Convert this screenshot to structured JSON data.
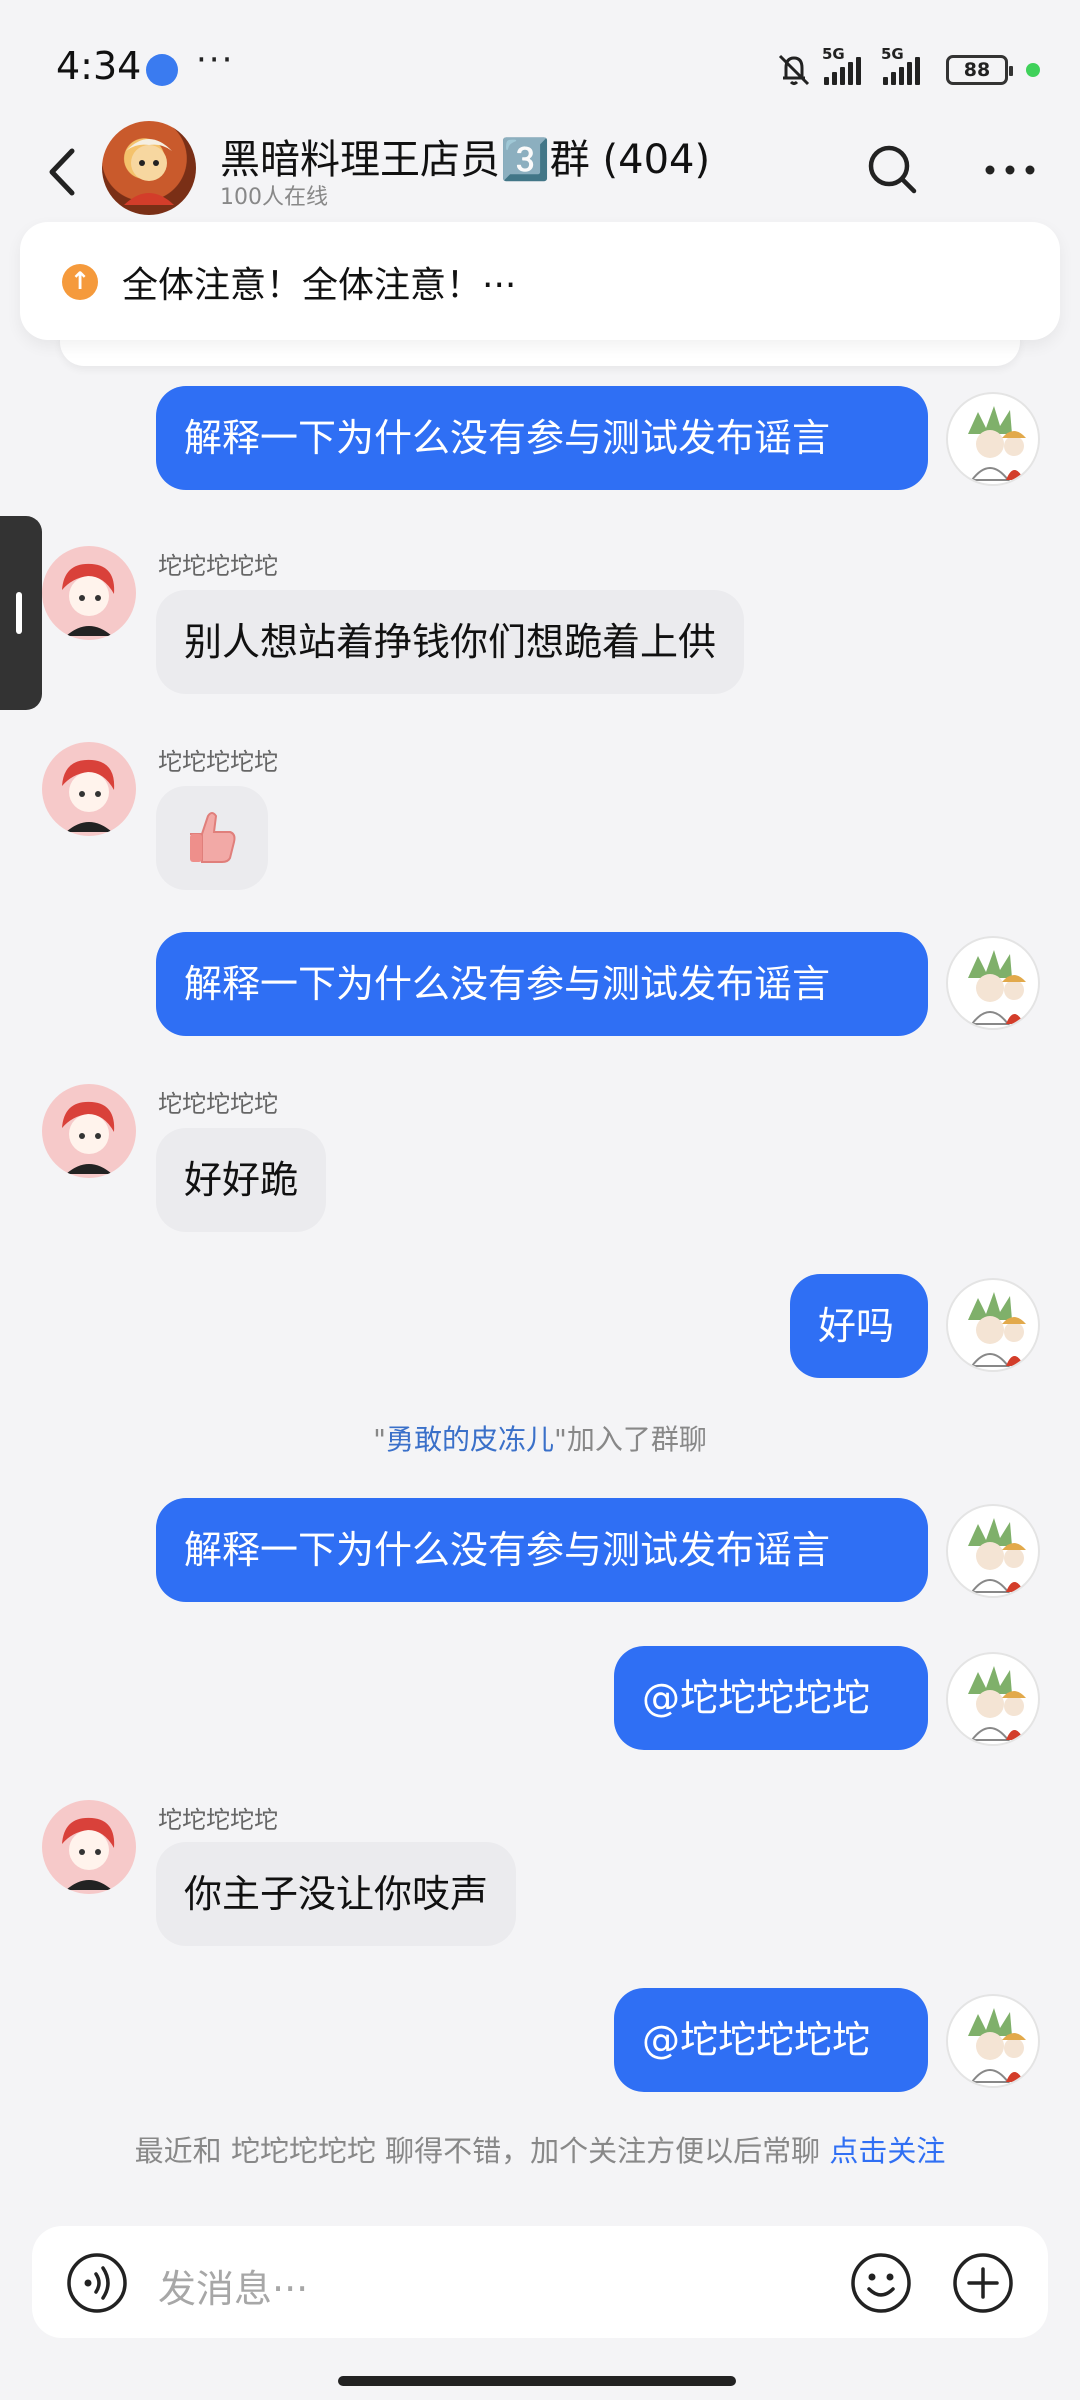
{
  "status_bar": {
    "time": "4:34",
    "dots": "···",
    "sim1_tag": "5G",
    "sim2_tag": "5G",
    "battery": "88"
  },
  "header": {
    "title": "黑暗料理王店员3️⃣群 (404)",
    "subtitle": "100人在线"
  },
  "announcement": {
    "text": "全体注意！全体注意！···"
  },
  "messages": [
    {
      "from": "self",
      "text": "解释一下为什么没有参与测试发布谣言"
    },
    {
      "from": "other",
      "sender": "坨坨坨坨坨",
      "text": "别人想站着挣钱你们想跪着上供"
    },
    {
      "from": "other",
      "sender": "坨坨坨坨坨",
      "emoji": "thumbs-up"
    },
    {
      "from": "self",
      "text": "解释一下为什么没有参与测试发布谣言"
    },
    {
      "from": "other",
      "sender": "坨坨坨坨坨",
      "text": "好好跪"
    },
    {
      "from": "self",
      "text": "好吗"
    },
    {
      "from": "system",
      "prefix": "\"",
      "nickname": "勇敢的皮冻儿",
      "suffix": "\"加入了群聊"
    },
    {
      "from": "self",
      "text": "解释一下为什么没有参与测试发布谣言"
    },
    {
      "from": "self",
      "text": "@坨坨坨坨坨"
    },
    {
      "from": "other",
      "sender": "坨坨坨坨坨",
      "text": "你主子没让你吱声"
    },
    {
      "from": "self",
      "text": "@坨坨坨坨坨"
    }
  ],
  "follow_hint": {
    "text": "最近和 坨坨坨坨坨 聊得不错，加个关注方便以后常聊 ",
    "link": "点击关注"
  },
  "input": {
    "placeholder": "发消息···"
  },
  "colors": {
    "self_bubble": "#2f6ff4",
    "other_bubble": "#ebebee",
    "link": "#2f6ff4"
  }
}
